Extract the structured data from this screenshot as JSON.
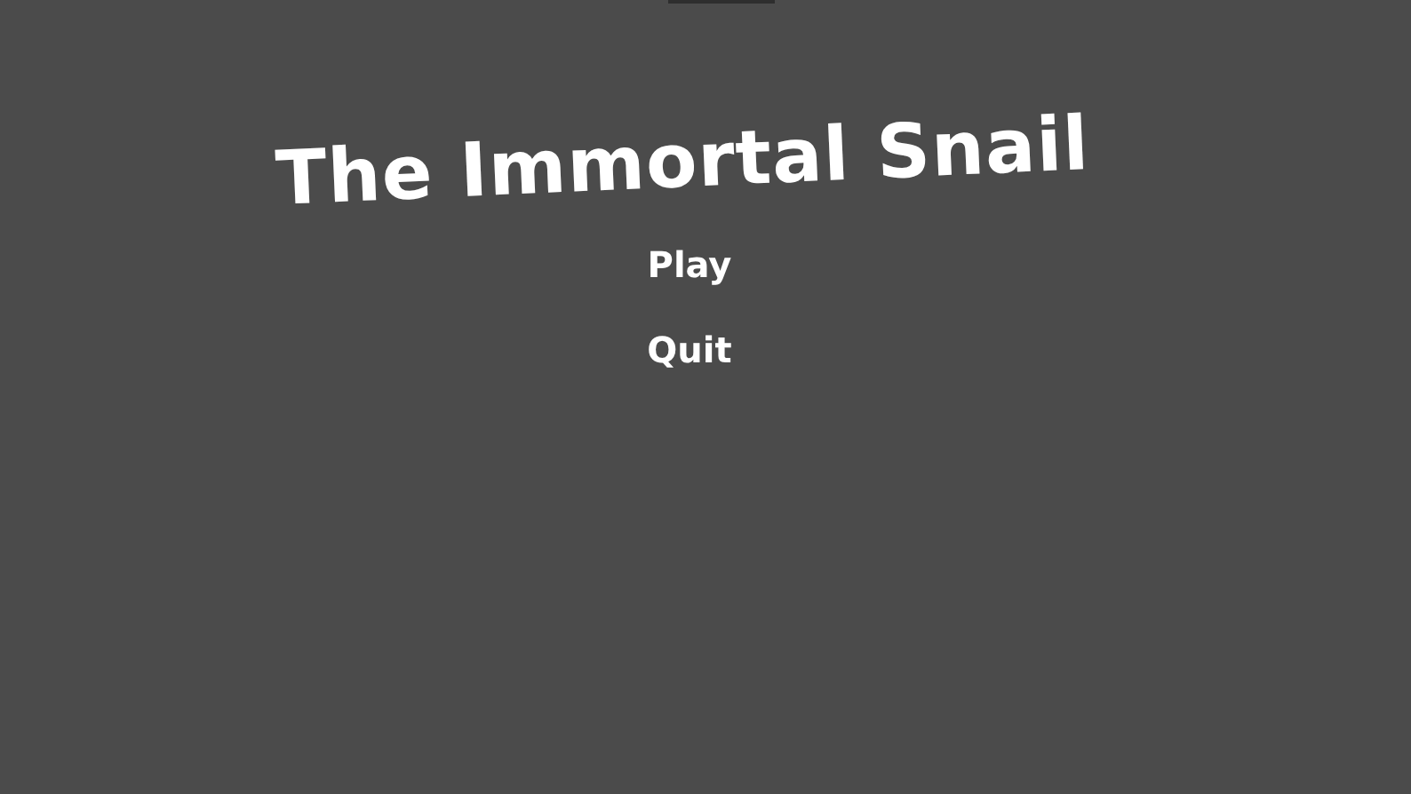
{
  "title": "The Immortal Snail",
  "menu": [
    {
      "label": "Play"
    },
    {
      "label": "Quit"
    }
  ]
}
